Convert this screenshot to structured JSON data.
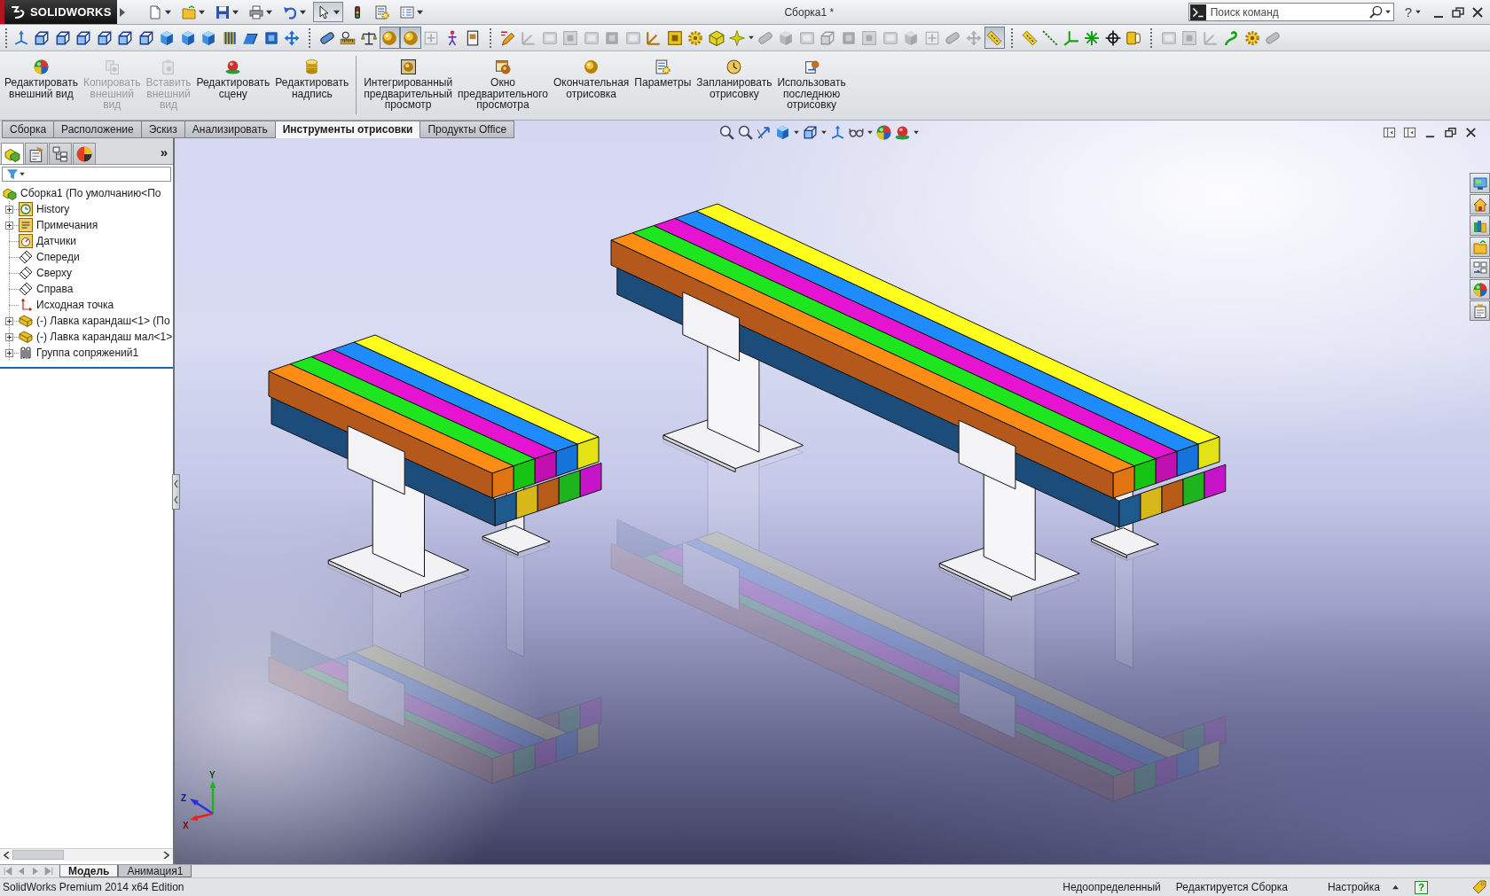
{
  "window": {
    "logo_text": "SOLIDWORKS",
    "title": "Сборка1 *",
    "help": "?"
  },
  "quick_access": [
    {
      "selected": false
    },
    {
      "selected": false
    },
    {
      "selected": false
    },
    {
      "selected": false
    },
    {
      "selected": false
    },
    {
      "selected": true
    },
    {
      "selected": false
    },
    {
      "selected": false
    },
    {
      "selected": false
    }
  ],
  "search": {
    "placeholder": "Поиск команд"
  },
  "command_toolbar": {
    "groups": [
      [
        {
          "disabled": false,
          "selected": false
        },
        {
          "disabled": false,
          "selected": false
        },
        {
          "disabled": false,
          "selected": false
        },
        {
          "disabled": false,
          "selected": false
        },
        {
          "disabled": false,
          "selected": false
        },
        {
          "disabled": false,
          "selected": false
        },
        {
          "disabled": false,
          "selected": false
        },
        {
          "disabled": false,
          "selected": false
        },
        {
          "disabled": false,
          "selected": false
        },
        {
          "disabled": false,
          "selected": false
        },
        {
          "disabled": false,
          "selected": false
        },
        {
          "disabled": false,
          "selected": false
        },
        {
          "disabled": false,
          "selected": false
        },
        {
          "disabled": false,
          "selected": false
        }
      ],
      [
        {
          "disabled": false,
          "selected": false
        },
        {
          "disabled": false,
          "selected": false
        },
        {
          "disabled": false,
          "selected": false
        },
        {
          "disabled": false,
          "selected": true
        },
        {
          "disabled": false,
          "selected": true
        },
        {
          "disabled": true,
          "selected": false
        },
        {
          "disabled": false,
          "selected": false
        },
        {
          "disabled": false,
          "selected": false
        }
      ],
      [
        {
          "disabled": false,
          "selected": false
        },
        {
          "disabled": true,
          "selected": false
        },
        {
          "disabled": true,
          "selected": false
        },
        {
          "disabled": true,
          "selected": false
        },
        {
          "disabled": true,
          "selected": false
        },
        {
          "disabled": true,
          "selected": false
        },
        {
          "disabled": true,
          "selected": false
        },
        {
          "disabled": false,
          "selected": false
        },
        {
          "disabled": false,
          "selected": false
        },
        {
          "disabled": false,
          "selected": false
        },
        {
          "disabled": false,
          "selected": false
        },
        {
          "disabled": false,
          "selected": false
        },
        {
          "disabled": true,
          "selected": false
        },
        {
          "disabled": true,
          "selected": false
        },
        {
          "disabled": true,
          "selected": false
        },
        {
          "disabled": true,
          "selected": false
        },
        {
          "disabled": true,
          "selected": false
        },
        {
          "disabled": true,
          "selected": false
        },
        {
          "disabled": true,
          "selected": false
        },
        {
          "disabled": true,
          "selected": false
        },
        {
          "disabled": true,
          "selected": false
        },
        {
          "disabled": true,
          "selected": false
        },
        {
          "disabled": true,
          "selected": false
        },
        {
          "disabled": false,
          "selected": true
        }
      ],
      [
        {
          "disabled": false,
          "selected": false
        },
        {
          "disabled": false,
          "selected": false
        },
        {
          "disabled": false,
          "selected": false
        },
        {
          "disabled": false,
          "selected": false
        },
        {
          "disabled": false,
          "selected": false
        },
        {
          "disabled": false,
          "selected": false
        }
      ],
      [
        {
          "disabled": true,
          "selected": false
        },
        {
          "disabled": true,
          "selected": false
        },
        {
          "disabled": true,
          "selected": false
        },
        {
          "disabled": false,
          "selected": false
        },
        {
          "disabled": false,
          "selected": false
        },
        {
          "disabled": true,
          "selected": false
        }
      ]
    ]
  },
  "ribbon": {
    "groups": [
      [
        {
          "label": "Редактировать\nвнешний вид",
          "disabled": false
        },
        {
          "label": "Копировать\nвнешний\nвид",
          "disabled": true
        },
        {
          "label": "Вставить\nвнешний\nвид",
          "disabled": true
        },
        {
          "label": "Редактировать\nсцену",
          "disabled": false
        },
        {
          "label": "Редактировать\nнадпись",
          "disabled": false
        }
      ],
      [
        {
          "label": "Интегрированный\nпредварительный\nпросмотр",
          "disabled": false
        },
        {
          "label": "Окно\nпредварительного\nпросмотра",
          "disabled": false
        },
        {
          "label": "Окончательная\nотрисовка",
          "disabled": false
        },
        {
          "label": "Параметры",
          "disabled": false
        },
        {
          "label": "Запланировать\nотрисовку",
          "disabled": false
        },
        {
          "label": "Использовать\nпоследнюю\nотрисовку",
          "disabled": false
        }
      ]
    ]
  },
  "tabs": [
    {
      "label": "Сборка",
      "selected": false
    },
    {
      "label": "Расположение",
      "selected": false
    },
    {
      "label": "Эскиз",
      "selected": false
    },
    {
      "label": "Анализировать",
      "selected": false
    },
    {
      "label": "Инструменты отрисовки",
      "selected": true
    },
    {
      "label": "Продукты Office",
      "selected": false
    }
  ],
  "feature_manager": {
    "panel_tabs": [
      {
        "selected": true
      },
      {
        "selected": false
      },
      {
        "selected": false
      },
      {
        "selected": false
      }
    ],
    "more": "»",
    "tree": {
      "label": "Сборка1 (По умолчанию<По",
      "kind": "assembly",
      "children": [
        {
          "label": "History",
          "kind": "history",
          "expanded": false
        },
        {
          "label": "Примечания",
          "kind": "annotations",
          "expanded": false
        },
        {
          "label": "Датчики",
          "kind": "sensors"
        },
        {
          "label": "Спереди",
          "kind": "plane"
        },
        {
          "label": "Сверху",
          "kind": "plane"
        },
        {
          "label": "Справа",
          "kind": "plane"
        },
        {
          "label": "Исходная точка",
          "kind": "origin"
        },
        {
          "label": "(-) Лавка карандаш<1> (По",
          "kind": "part",
          "expanded": false
        },
        {
          "label": "(-) Лавка карандаш мал<1>",
          "kind": "part",
          "expanded": false
        },
        {
          "label": "Группа сопряжений1",
          "kind": "mates",
          "expanded": false
        }
      ]
    }
  },
  "triad": {
    "x": "X",
    "y": "Y",
    "z": "Z"
  },
  "bottom_tabs": [
    {
      "label": "Модель",
      "selected": true
    },
    {
      "label": "Анимация1",
      "selected": false
    }
  ],
  "status_bar": {
    "edition": "SolidWorks Premium 2014 x64 Edition",
    "items": [
      "Недоопределенный",
      "Редактируется Сборка",
      "Настройка"
    ],
    "help": "?"
  }
}
